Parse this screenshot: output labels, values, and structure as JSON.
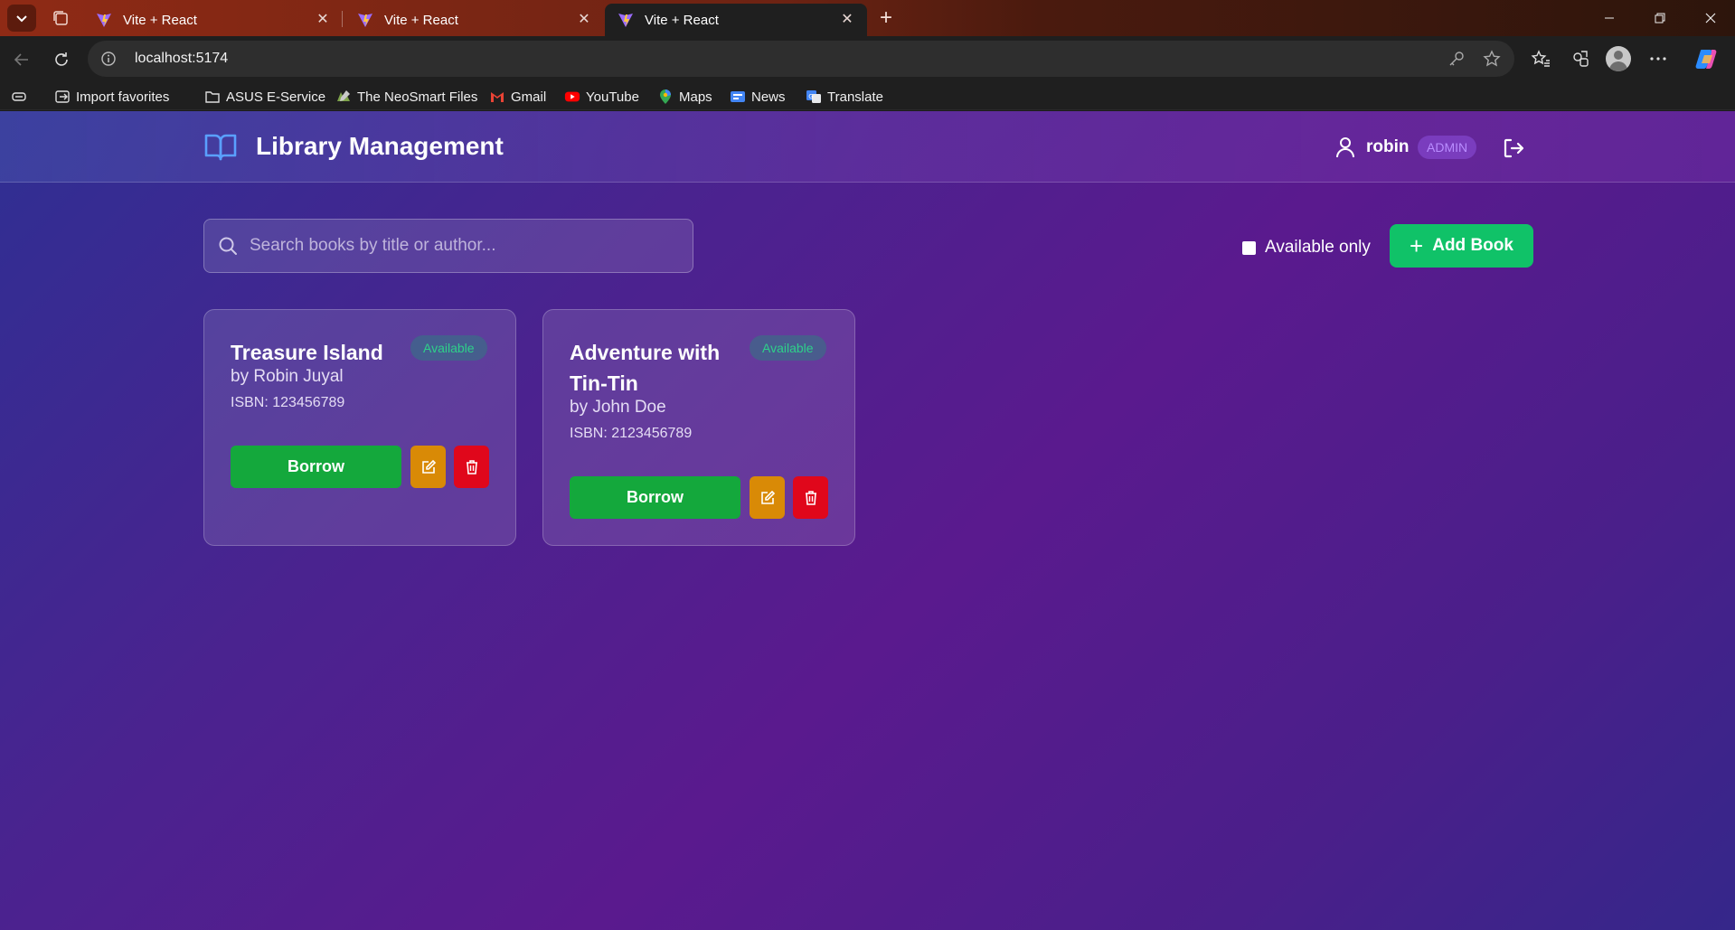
{
  "browser": {
    "tabs": [
      {
        "title": "Vite + React",
        "active": false
      },
      {
        "title": "Vite + React",
        "active": false
      },
      {
        "title": "Vite + React",
        "active": true
      }
    ],
    "url": "localhost:5174",
    "bookmarks": [
      {
        "label": "Import favorites",
        "icon": "import-icon"
      },
      {
        "label": "ASUS E-Service",
        "icon": "folder-icon"
      },
      {
        "label": "The NeoSmart Files",
        "icon": "neosmart-icon"
      },
      {
        "label": "Gmail",
        "icon": "gmail-icon"
      },
      {
        "label": "YouTube",
        "icon": "youtube-icon"
      },
      {
        "label": "Maps",
        "icon": "maps-icon"
      },
      {
        "label": "News",
        "icon": "news-icon"
      },
      {
        "label": "Translate",
        "icon": "translate-icon"
      }
    ]
  },
  "app": {
    "title": "Library Management",
    "user": {
      "name": "robin",
      "role": "ADMIN"
    },
    "search": {
      "placeholder": "Search books by title or author...",
      "value": ""
    },
    "filter": {
      "label": "Available only",
      "checked": false
    },
    "add_button": "Add Book",
    "colors": {
      "accent_green": "#10c268",
      "borrow_green": "#14a83c",
      "edit_orange": "#d98a06",
      "delete_red": "#e0071b",
      "logo_blue": "#5aa0ff"
    }
  },
  "books": [
    {
      "title": "Treasure Island",
      "status": "Available",
      "author": "by Robin Juyal",
      "isbn": "ISBN: 123456789",
      "action": "Borrow"
    },
    {
      "title": "Adventure with Tin-Tin",
      "status": "Available",
      "author": "by John Doe",
      "isbn": "ISBN: 2123456789",
      "action": "Borrow"
    }
  ]
}
